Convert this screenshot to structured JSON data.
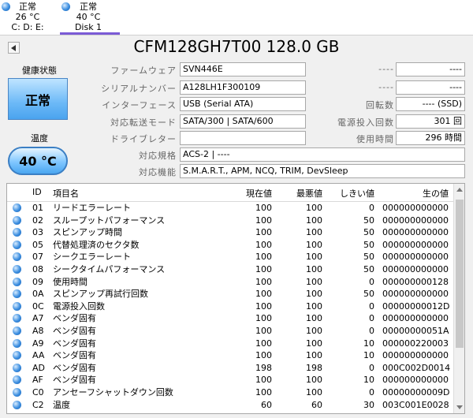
{
  "tabs": [
    {
      "status": "正常",
      "temp": "26 °C",
      "label": "C: D: E:"
    },
    {
      "status": "正常",
      "temp": "40 °C",
      "label": "Disk 1"
    }
  ],
  "title": "CFM128GH7T00 128.0 GB",
  "health": {
    "label": "健康状態",
    "value": "正常"
  },
  "temperature": {
    "label": "温度",
    "value": "40 °C"
  },
  "fields": {
    "firmware": {
      "label": "ファームウェア",
      "value": "SVN446E"
    },
    "serial": {
      "label": "シリアルナンバー",
      "value": "A128LH1F300109"
    },
    "interface": {
      "label": "インターフェース",
      "value": "USB (Serial ATA)"
    },
    "transfer": {
      "label": "対応転送モード",
      "value": "SATA/300 | SATA/600"
    },
    "drive_letter": {
      "label": "ドライブレター",
      "value": ""
    },
    "standard": {
      "label": "対応規格",
      "value": "ACS-2 | ----"
    },
    "features": {
      "label": "対応機能",
      "value": "S.M.A.R.T., APM, NCQ, TRIM, DevSleep"
    }
  },
  "right_fields": {
    "r1": {
      "label": "----",
      "value": "----"
    },
    "r2": {
      "label": "----",
      "value": "----"
    },
    "rotation": {
      "label": "回転数",
      "value": "---- (SSD)"
    },
    "power_count": {
      "label": "電源投入回数",
      "value": "301 回"
    },
    "power_hours": {
      "label": "使用時間",
      "value": "296 時間"
    }
  },
  "table": {
    "headers": {
      "id": "ID",
      "name": "項目名",
      "current": "現在値",
      "worst": "最悪値",
      "threshold": "しきい値",
      "raw": "生の値"
    },
    "rows": [
      {
        "id": "01",
        "name": "リードエラーレート",
        "current": "100",
        "worst": "100",
        "threshold": "0",
        "raw": "000000000000"
      },
      {
        "id": "02",
        "name": "スループットパフォーマンス",
        "current": "100",
        "worst": "100",
        "threshold": "50",
        "raw": "000000000000"
      },
      {
        "id": "03",
        "name": "スピンアップ時間",
        "current": "100",
        "worst": "100",
        "threshold": "50",
        "raw": "000000000000"
      },
      {
        "id": "05",
        "name": "代替処理済のセクタ数",
        "current": "100",
        "worst": "100",
        "threshold": "50",
        "raw": "000000000000"
      },
      {
        "id": "07",
        "name": "シークエラーレート",
        "current": "100",
        "worst": "100",
        "threshold": "50",
        "raw": "000000000000"
      },
      {
        "id": "08",
        "name": "シークタイムパフォーマンス",
        "current": "100",
        "worst": "100",
        "threshold": "50",
        "raw": "000000000000"
      },
      {
        "id": "09",
        "name": "使用時間",
        "current": "100",
        "worst": "100",
        "threshold": "0",
        "raw": "000000000128"
      },
      {
        "id": "0A",
        "name": "スピンアップ再試行回数",
        "current": "100",
        "worst": "100",
        "threshold": "50",
        "raw": "000000000000"
      },
      {
        "id": "0C",
        "name": "電源投入回数",
        "current": "100",
        "worst": "100",
        "threshold": "0",
        "raw": "00000000012D"
      },
      {
        "id": "A7",
        "name": "ベンダ固有",
        "current": "100",
        "worst": "100",
        "threshold": "0",
        "raw": "000000000000"
      },
      {
        "id": "A8",
        "name": "ベンダ固有",
        "current": "100",
        "worst": "100",
        "threshold": "0",
        "raw": "00000000051A"
      },
      {
        "id": "A9",
        "name": "ベンダ固有",
        "current": "100",
        "worst": "100",
        "threshold": "10",
        "raw": "000000220003"
      },
      {
        "id": "AA",
        "name": "ベンダ固有",
        "current": "100",
        "worst": "100",
        "threshold": "10",
        "raw": "000000000000"
      },
      {
        "id": "AD",
        "name": "ベンダ固有",
        "current": "198",
        "worst": "198",
        "threshold": "0",
        "raw": "000C002D0014"
      },
      {
        "id": "AF",
        "name": "ベンダ固有",
        "current": "100",
        "worst": "100",
        "threshold": "10",
        "raw": "000000000000"
      },
      {
        "id": "C0",
        "name": "アンセーフシャットダウン回数",
        "current": "100",
        "worst": "100",
        "threshold": "0",
        "raw": "00000000009D"
      },
      {
        "id": "C2",
        "name": "温度",
        "current": "60",
        "worst": "60",
        "threshold": "30",
        "raw": "003C001E0028"
      }
    ]
  }
}
